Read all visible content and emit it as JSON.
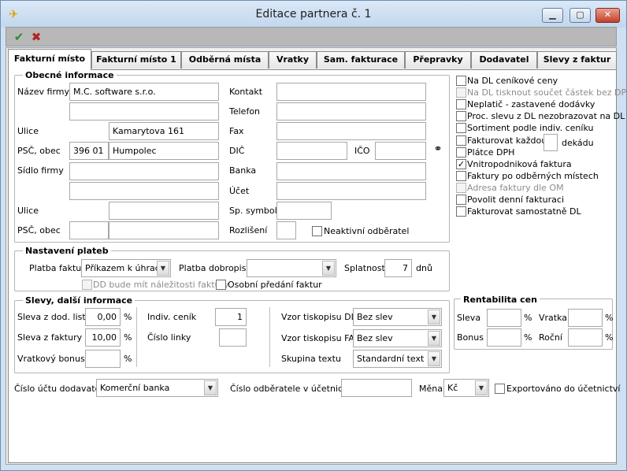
{
  "window": {
    "title": "Editace partnera č. 1",
    "minimize": "▁",
    "maximize": "▢",
    "close": "✕"
  },
  "toolbar": {
    "ok_icon": "✔",
    "cancel_icon": "✖"
  },
  "tabs": [
    "Fakturní místo",
    "Fakturní místo 1",
    "Odběrná místa",
    "Vratky",
    "Sam. fakturace",
    "Přepravky",
    "Dodavatel",
    "Slevy z faktur"
  ],
  "obecne": {
    "legend": "Obecné informace",
    "nazev_label": "Název firmy",
    "nazev_value": "M.C. software s.r.o.",
    "nazev_value2": "",
    "ulice_label": "Ulice",
    "ulice_value": "Kamarytova 161",
    "psc_label": "PSČ, obec",
    "psc_value": "396 01",
    "obec_value": "Humpolec",
    "sidlo_label": "Sídlo firmy",
    "sidlo_value": "",
    "sidlo_value2": "",
    "ulice2_label": "Ulice",
    "ulice2_value": "",
    "psc2_label": "PSČ, obec",
    "psc2_value": "",
    "obec2_value": "",
    "kontakt_label": "Kontakt",
    "kontakt_value": "",
    "telefon_label": "Telefon",
    "telefon_value": "",
    "fax_label": "Fax",
    "fax_value": "",
    "dic_label": "DIČ",
    "dic_value": "",
    "ico_label": "IČO",
    "ico_value": "",
    "banka_label": "Banka",
    "banka_value": "",
    "ucet_label": "Účet",
    "ucet_value": "",
    "spsymbol_label": "Sp. symbol",
    "spsymbol_value": "",
    "rozliseni_label": "Rozlišení",
    "rozliseni_value": "",
    "neaktivni_label": "Neaktivní odběratel"
  },
  "options": [
    {
      "label": "Na DL ceníkové ceny",
      "checked": false,
      "disabled": false
    },
    {
      "label": "Na DL tisknout součet částek bez DPH",
      "checked": false,
      "disabled": true
    },
    {
      "label": "Neplatič - zastavené dodávky",
      "checked": false,
      "disabled": false
    },
    {
      "label": "Proc. slevu z DL nezobrazovat na DL",
      "checked": false,
      "disabled": false
    },
    {
      "label": "Sortiment podle indiv. ceníku",
      "checked": false,
      "disabled": false
    },
    {
      "label": "Fakturovat každou",
      "checked": false,
      "disabled": false,
      "suffix": "dekádu"
    },
    {
      "label": "Plátce DPH",
      "checked": false,
      "disabled": false
    },
    {
      "label": "Vnitropodniková faktura",
      "checked": true,
      "disabled": false
    },
    {
      "label": "Faktury po odběrných místech",
      "checked": false,
      "disabled": false
    },
    {
      "label": "Adresa faktury dle OM",
      "checked": false,
      "disabled": true
    },
    {
      "label": "Povolit denní fakturaci",
      "checked": false,
      "disabled": false
    },
    {
      "label": "Fakturovat samostatně DL",
      "checked": false,
      "disabled": false
    }
  ],
  "platby": {
    "legend": "Nastavení plateb",
    "platba_faktur_label": "Platba faktur",
    "platba_faktur_value": "Příkazem k úhradě",
    "platba_dobropisu_label": "Platba dobropisu",
    "platba_dobropisu_value": "",
    "splatnost_label": "Splatnost",
    "splatnost_value": "7",
    "dnu_label": "dnů",
    "dd_label": "DD bude mít náležitosti faktury",
    "osobni_label": "Osobní předání faktur"
  },
  "slevy": {
    "legend": "Slevy, další informace",
    "sleva_dod_label": "Sleva z dod. listů",
    "sleva_dod_value": "0,00",
    "sleva_fak_label": "Sleva z faktury",
    "sleva_fak_value": "10,00",
    "vratkovy_label": "Vratkový bonus",
    "vratkovy_value": "",
    "pct": "%",
    "indiv_label": "Indiv. ceník",
    "indiv_value": "1",
    "cislo_linky_label": "Číslo linky",
    "cislo_linky_value": "",
    "vzor_dl_label": "Vzor tiskopisu DL",
    "vzor_dl_value": "Bez slev",
    "vzor_fa_label": "Vzor tiskopisu FA",
    "vzor_fa_value": "Bez slev",
    "skupina_label": "Skupina textu",
    "skupina_value": "Standardní text"
  },
  "rentabilita": {
    "legend": "Rentabilita cen",
    "sleva_label": "Sleva",
    "sleva_value": "",
    "vratka_label": "Vratka",
    "vratka_value": "",
    "bonus_label": "Bonus",
    "bonus_value": "",
    "rocni_label": "Roční",
    "rocni_value": "",
    "pct": "%"
  },
  "bottom": {
    "ucet_dod_label": "Číslo účtu dodavatele",
    "ucet_dod_value": "Komerční banka",
    "cislo_odb_label": "Číslo odběratele v účetnictví",
    "cislo_odb_value": "",
    "mena_label": "Měna",
    "mena_value": "Kč",
    "export_label": "Exportováno do účetnictví"
  },
  "colors": {
    "accent_green": "#2e8b2e",
    "accent_red": "#b22222"
  }
}
